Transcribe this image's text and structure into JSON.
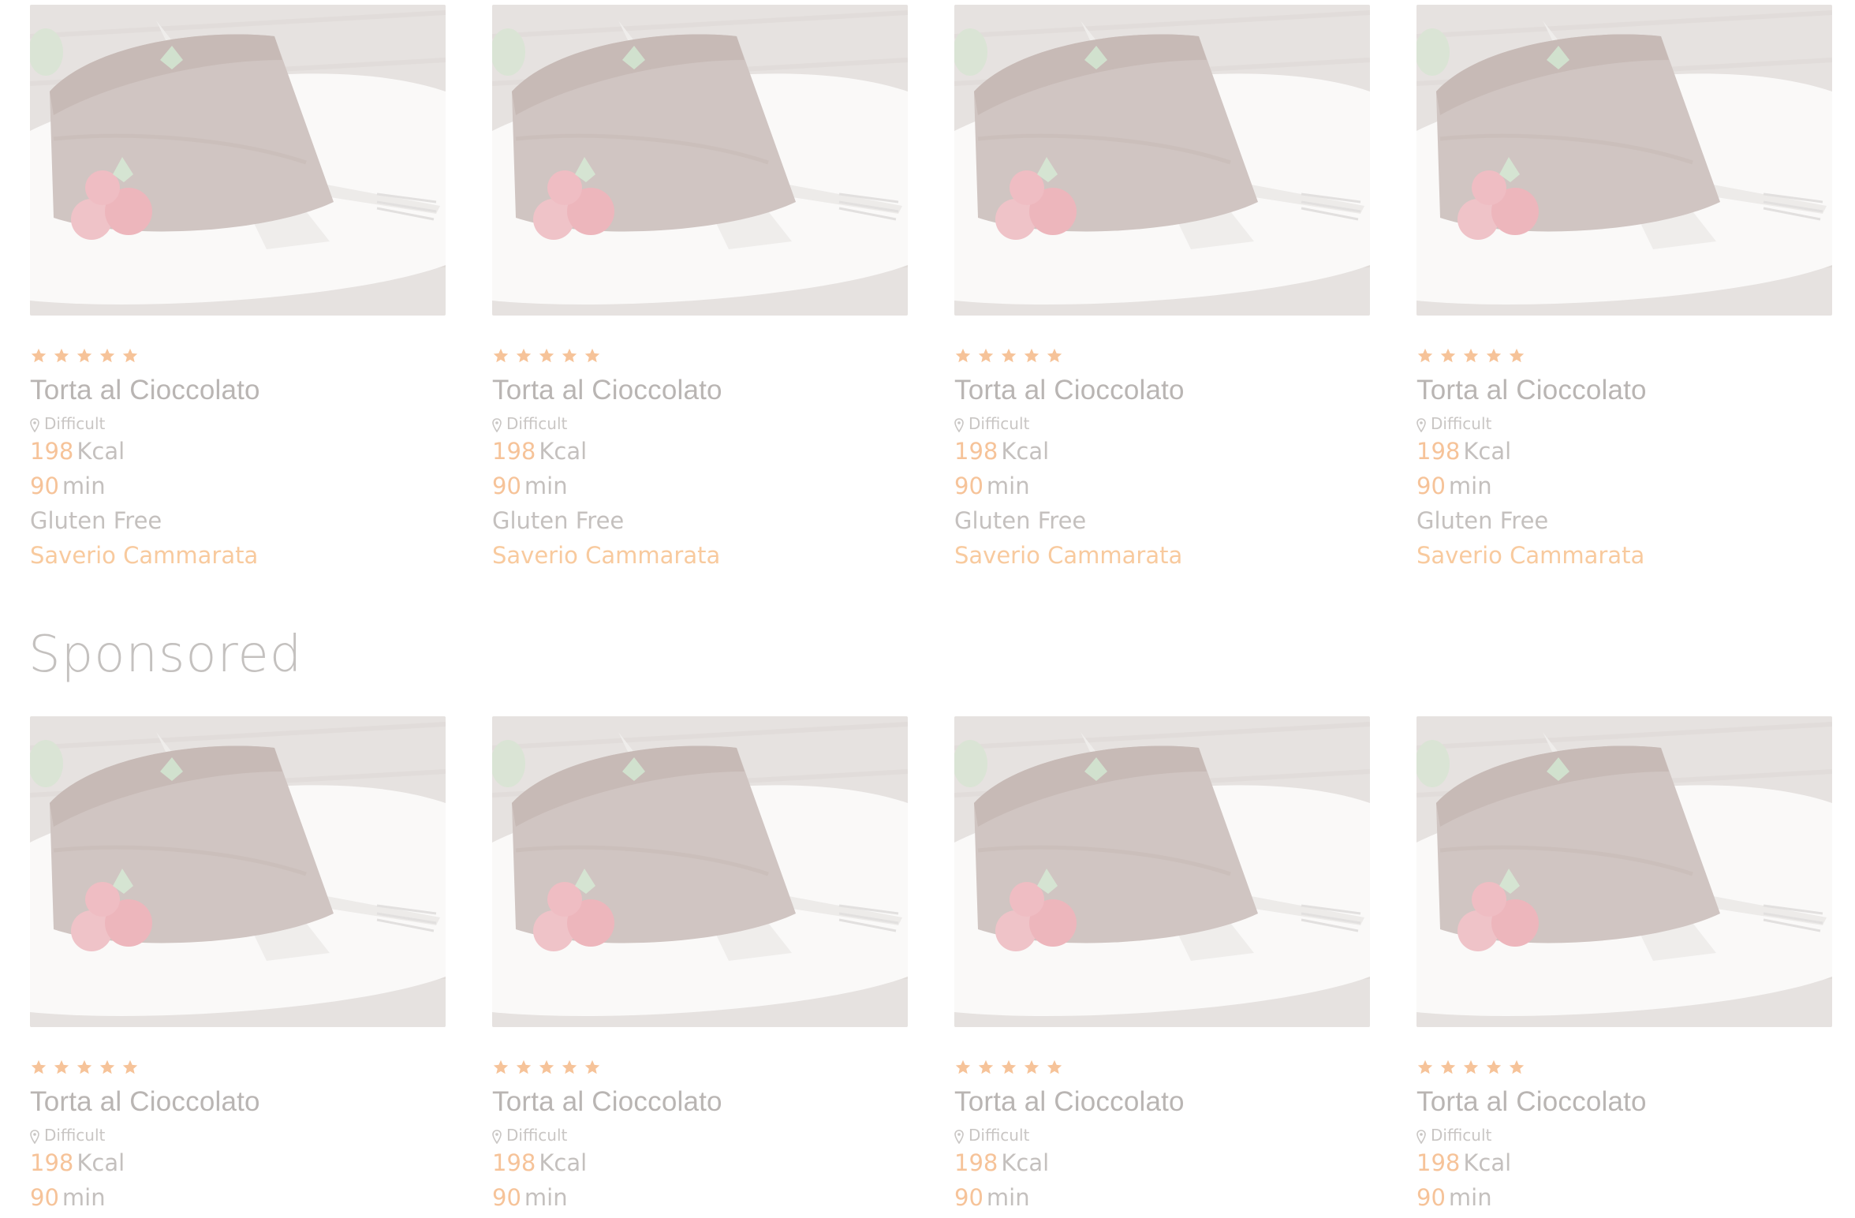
{
  "rows": [
    {
      "cards": [
        {
          "rating": 5,
          "title": "Torta al Cioccolato",
          "difficulty": "Difficult",
          "kcal_value": "198",
          "kcal_unit": "Kcal",
          "time_value": "90",
          "time_unit": "min",
          "diet": "Gluten Free",
          "author": "Saverio Cammarata"
        },
        {
          "rating": 5,
          "title": "Torta al Cioccolato",
          "difficulty": "Difficult",
          "kcal_value": "198",
          "kcal_unit": "Kcal",
          "time_value": "90",
          "time_unit": "min",
          "diet": "Gluten Free",
          "author": "Saverio Cammarata"
        },
        {
          "rating": 5,
          "title": "Torta al Cioccolato",
          "difficulty": "Difficult",
          "kcal_value": "198",
          "kcal_unit": "Kcal",
          "time_value": "90",
          "time_unit": "min",
          "diet": "Gluten Free",
          "author": "Saverio Cammarata"
        },
        {
          "rating": 5,
          "title": "Torta al Cioccolato",
          "difficulty": "Difficult",
          "kcal_value": "198",
          "kcal_unit": "Kcal",
          "time_value": "90",
          "time_unit": "min",
          "diet": "Gluten Free",
          "author": "Saverio Cammarata"
        }
      ]
    },
    {
      "cards": [
        {
          "rating": 5,
          "title": "Torta al Cioccolato",
          "difficulty": "Difficult",
          "kcal_value": "198",
          "kcal_unit": "Kcal",
          "time_value": "90",
          "time_unit": "min"
        },
        {
          "rating": 5,
          "title": "Torta al Cioccolato",
          "difficulty": "Difficult",
          "kcal_value": "198",
          "kcal_unit": "Kcal",
          "time_value": "90",
          "time_unit": "min"
        },
        {
          "rating": 5,
          "title": "Torta al Cioccolato",
          "difficulty": "Difficult",
          "kcal_value": "198",
          "kcal_unit": "Kcal",
          "time_value": "90",
          "time_unit": "min"
        },
        {
          "rating": 5,
          "title": "Torta al Cioccolato",
          "difficulty": "Difficult",
          "kcal_value": "198",
          "kcal_unit": "Kcal",
          "time_value": "90",
          "time_unit": "min"
        }
      ]
    }
  ],
  "sponsored_heading": "Sponsored",
  "icons": {
    "star": "star-icon",
    "difficulty": "map-marker-icon",
    "image": "chocolate-cake-photo"
  },
  "colors": {
    "accent": "#f6c399",
    "text_muted": "#c4c0be",
    "title": "#b9b5b3"
  }
}
